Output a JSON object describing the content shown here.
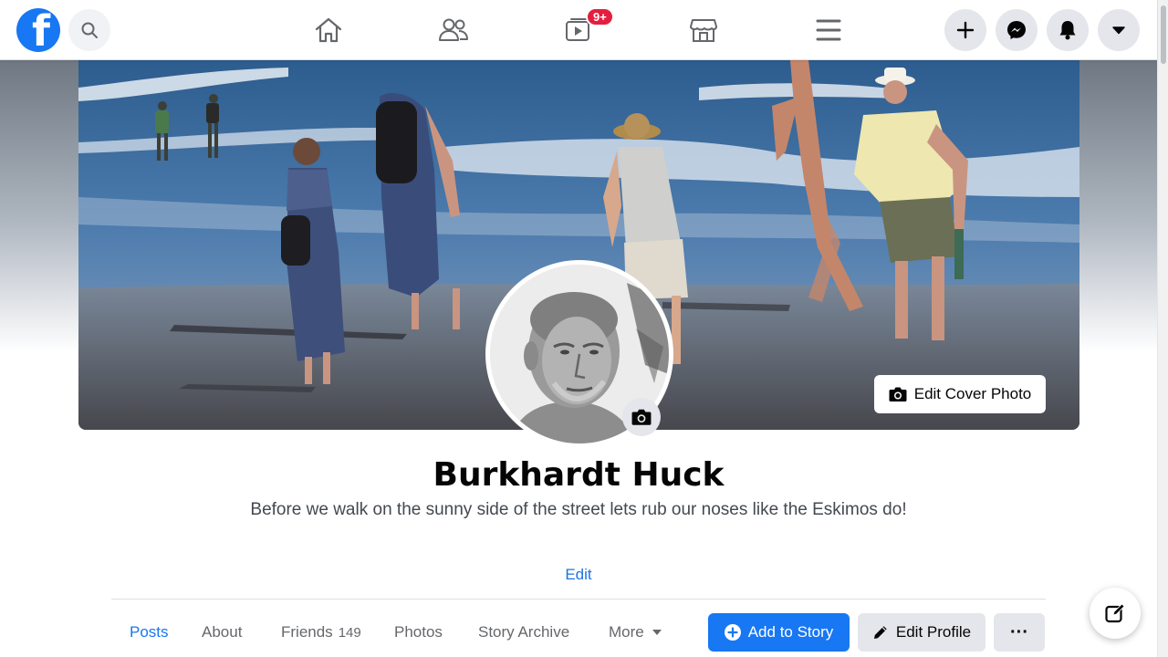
{
  "nav": {
    "logo_letter": "f",
    "video_badge": "9+",
    "icons": [
      "search-icon",
      "home-icon",
      "friends-icon",
      "watch-icon",
      "marketplace-icon",
      "menu-icon",
      "plus-icon",
      "messenger-icon",
      "notifications-icon",
      "account-caret-icon"
    ]
  },
  "cover": {
    "edit_label": "Edit Cover Photo"
  },
  "profile": {
    "name": "Burkhardt Huck",
    "bio": "Before we walk on the sunny side of the street lets rub our noses like the Eskimos do!",
    "edit_bio_label": "Edit"
  },
  "tabs": [
    {
      "label": "Posts",
      "active": true
    },
    {
      "label": "About"
    },
    {
      "label": "Friends",
      "count": "149"
    },
    {
      "label": "Photos"
    },
    {
      "label": "Story Archive"
    },
    {
      "label": "More"
    }
  ],
  "actions": {
    "add_story": "Add to Story",
    "edit_profile": "Edit Profile",
    "more": "···"
  },
  "colors": {
    "brand": "#1877f2",
    "badge": "#e41e3f",
    "secondary_button": "#e4e6eb"
  }
}
